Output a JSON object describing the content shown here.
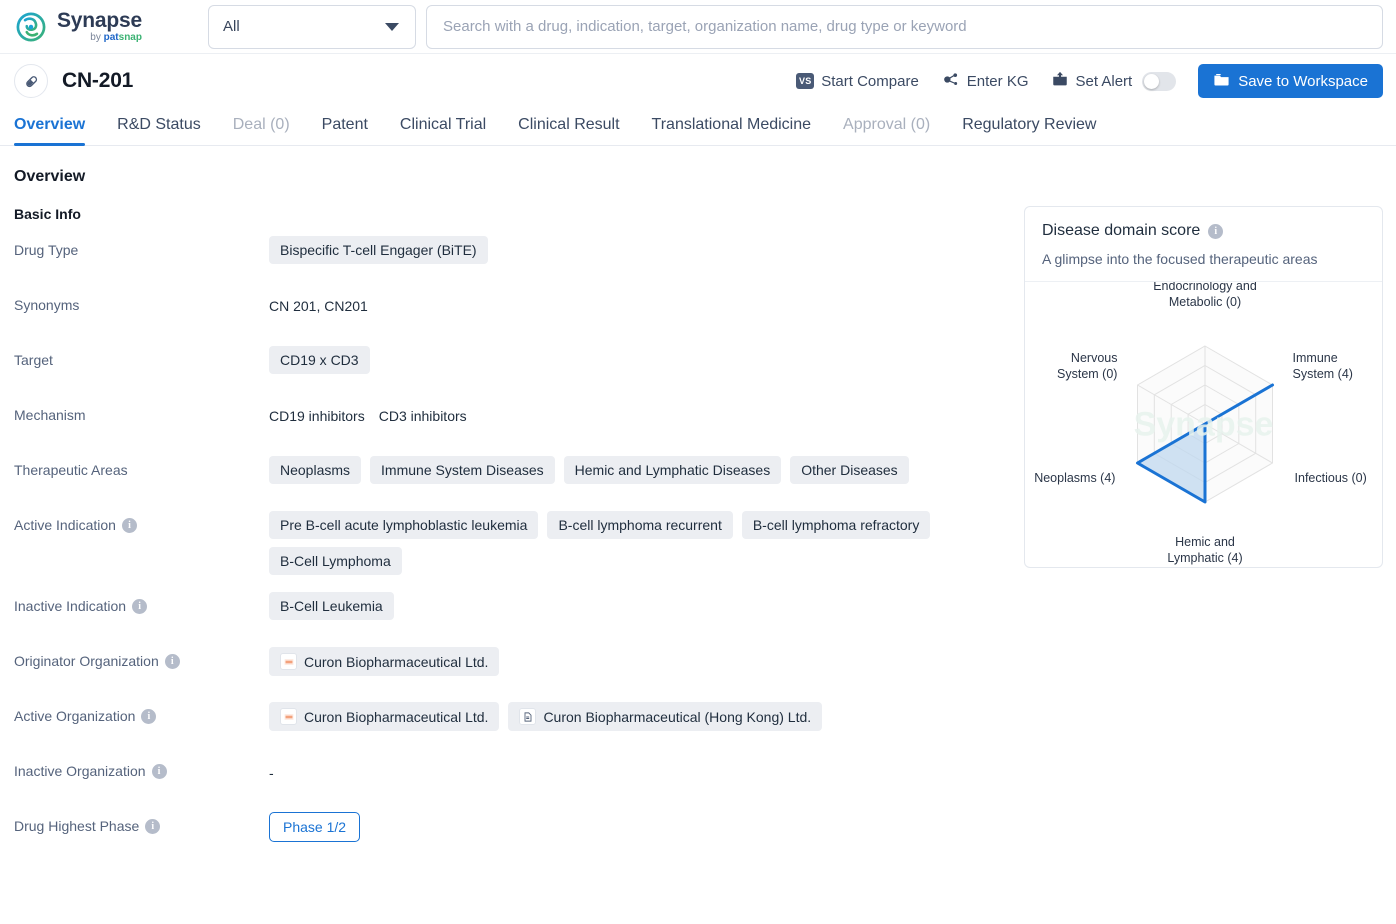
{
  "brand": {
    "name": "Synapse",
    "by": "by ",
    "pat": "pat",
    "snap": "snap"
  },
  "search": {
    "scope_value": "All",
    "placeholder": "Search with a drug, indication, target, organization name, drug type or keyword"
  },
  "drug_header": {
    "name": "CN-201",
    "start_compare": "Start Compare",
    "vs_label": "VS",
    "enter_kg": "Enter KG",
    "set_alert": "Set Alert",
    "save_to_workspace": "Save to Workspace",
    "accent_color": "#1a73d4"
  },
  "tabs": [
    {
      "label": "Overview",
      "state": "active"
    },
    {
      "label": "R&D Status",
      "state": "normal"
    },
    {
      "label": "Deal (0)",
      "state": "muted"
    },
    {
      "label": "Patent",
      "state": "normal"
    },
    {
      "label": "Clinical Trial",
      "state": "normal"
    },
    {
      "label": "Clinical Result",
      "state": "normal"
    },
    {
      "label": "Translational Medicine",
      "state": "normal"
    },
    {
      "label": "Approval (0)",
      "state": "muted"
    },
    {
      "label": "Regulatory Review",
      "state": "normal"
    }
  ],
  "overview": {
    "heading": "Overview",
    "section": "Basic Info",
    "labels": {
      "drug_type": "Drug Type",
      "synonyms": "Synonyms",
      "target": "Target",
      "mechanism": "Mechanism",
      "therapeutic_areas": "Therapeutic Areas",
      "active_indication": "Active Indication",
      "inactive_indication": "Inactive Indication",
      "originator_organization": "Originator Organization",
      "active_organization": "Active Organization",
      "inactive_organization": "Inactive Organization",
      "drug_highest_phase": "Drug Highest Phase"
    },
    "drug_type": "Bispecific T-cell Engager (BiTE)",
    "synonyms": "CN 201,  CN201",
    "target": "CD19 x CD3",
    "mechanism": [
      "CD19 inhibitors",
      "CD3 inhibitors"
    ],
    "therapeutic_areas": [
      "Neoplasms",
      "Immune System Diseases",
      "Hemic and Lymphatic Diseases",
      "Other Diseases"
    ],
    "active_indication": [
      "Pre B-cell acute lymphoblastic leukemia",
      "B-cell lymphoma recurrent",
      "B-cell lymphoma refractory",
      "B-Cell Lymphoma"
    ],
    "inactive_indication": [
      "B-Cell Leukemia"
    ],
    "originator_organization": [
      "Curon Biopharmaceutical Ltd."
    ],
    "active_organization": [
      "Curon Biopharmaceutical Ltd.",
      "Curon Biopharmaceutical (Hong Kong) Ltd."
    ],
    "inactive_organization": "-",
    "drug_highest_phase": "Phase 1/2"
  },
  "radar_panel": {
    "title": "Disease domain score",
    "subtitle": "A glimpse into the focused therapeutic areas",
    "watermark": "Synapse"
  },
  "chart_data": {
    "type": "radar",
    "title": "Disease domain score",
    "subtitle": "A glimpse into the focused therapeutic areas",
    "categories": [
      "Endocrinology and Metabolic (0)",
      "Immune System (4)",
      "Infectious (0)",
      "Hemic and Lymphatic (4)",
      "Neoplasms (4)",
      "Nervous System (0)"
    ],
    "category_names": [
      "Endocrinology and Metabolic",
      "Immune System",
      "Infectious",
      "Hemic and Lymphatic",
      "Neoplasms",
      "Nervous System"
    ],
    "values": [
      0,
      4,
      0,
      4,
      4,
      0
    ],
    "max": 4,
    "rings": 4,
    "line_color": "#1a73d4",
    "fill_color": "#bed7ef",
    "grid_color": "#e2e2e2",
    "legend": "none"
  }
}
